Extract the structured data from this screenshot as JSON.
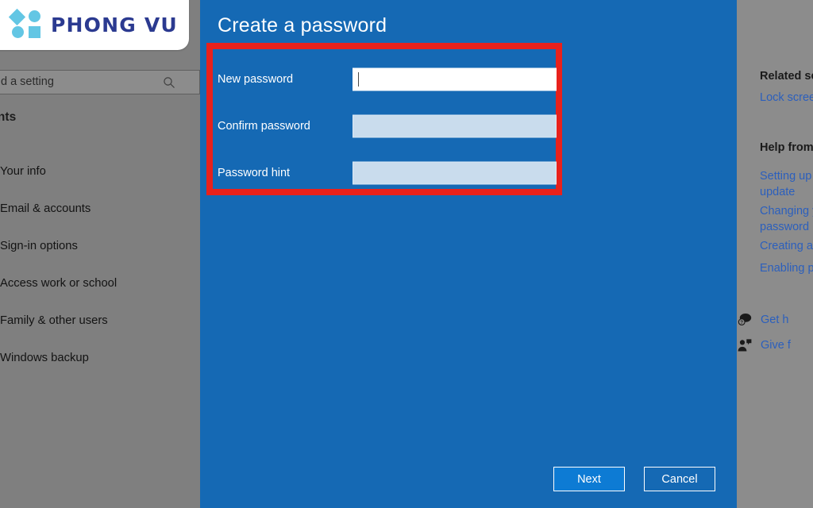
{
  "brand": {
    "name": "PHONG VU",
    "logo_shapes": [
      "diamond-icon",
      "circle-icon",
      "circle-icon",
      "square-icon"
    ],
    "logo_mark_color": "#63c6e4",
    "logo_text_color": "#2b3a90"
  },
  "sidebar": {
    "search": {
      "visible_text": "d a setting",
      "placeholder": "Find a setting",
      "icon": "search-icon"
    },
    "section_heading": "ounts",
    "items": [
      {
        "label": "Your info"
      },
      {
        "label": "Email & accounts"
      },
      {
        "label": "Sign-in options"
      },
      {
        "label": "Access work or school"
      },
      {
        "label": "Family & other users"
      },
      {
        "label": "Windows backup"
      }
    ]
  },
  "main": {
    "title": "Create a password",
    "highlight_color": "#e8211c",
    "background_color": "#1569b4",
    "fields": [
      {
        "label": "New password",
        "value": "",
        "focused": true
      },
      {
        "label": "Confirm password",
        "value": "",
        "focused": false
      },
      {
        "label": "Password hint",
        "value": "",
        "focused": false
      }
    ],
    "buttons": {
      "next": "Next",
      "cancel": "Cancel"
    }
  },
  "right_panel": {
    "related_settings_heading": "Related set",
    "related_settings_links": [
      {
        "label": "Lock scree"
      }
    ],
    "help_heading": "Help from",
    "help_links": [
      {
        "label": "Setting up update"
      },
      {
        "label": "Changing y password"
      },
      {
        "label": "Creating a"
      },
      {
        "label": "Enabling p"
      }
    ],
    "footer": [
      {
        "label": "Get h",
        "icon": "help-bubble-icon"
      },
      {
        "label": "Give f",
        "icon": "feedback-person-icon"
      }
    ]
  }
}
